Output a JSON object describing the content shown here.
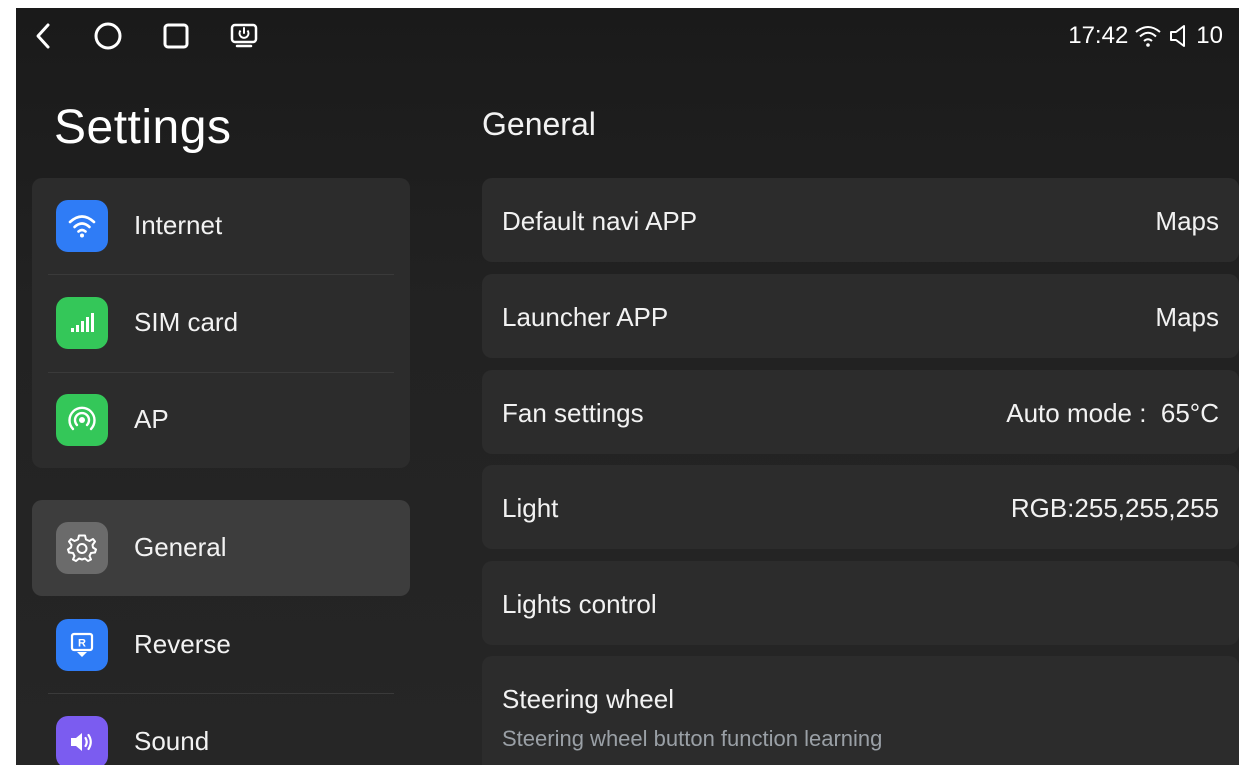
{
  "status_bar": {
    "nav": [
      {
        "icon": "back-icon"
      },
      {
        "icon": "home-icon"
      },
      {
        "icon": "recents-icon"
      },
      {
        "icon": "screen-power-icon"
      }
    ],
    "time": "17:42",
    "wifi_icon": "wifi-icon",
    "volume_icon": "volume-icon",
    "volume_level": "10"
  },
  "sidebar": {
    "title": "Settings",
    "items": [
      {
        "label": "Internet",
        "icon": "wifi-icon",
        "color": "#2f7cf6"
      },
      {
        "label": "SIM card",
        "icon": "signal-icon",
        "color": "#34c759"
      },
      {
        "label": "AP",
        "icon": "hotspot-icon",
        "color": "#34c759"
      },
      {
        "label": "General",
        "icon": "gear-icon",
        "color": "#6b6b6b",
        "selected": true
      },
      {
        "label": "Reverse",
        "icon": "reverse-camera-icon",
        "color": "#2f7cf6"
      },
      {
        "label": "Sound",
        "icon": "speaker-icon",
        "color": "#7b5cf0"
      }
    ]
  },
  "main": {
    "title": "General",
    "rows": [
      {
        "label": "Default navi APP",
        "value": "Maps"
      },
      {
        "label": "Launcher APP",
        "value": "Maps"
      },
      {
        "label": "Fan settings",
        "value": "Auto mode :  65°C"
      },
      {
        "label": "Light",
        "value": "RGB:255,255,255"
      },
      {
        "label": "Lights control",
        "value": ""
      },
      {
        "label": "Steering wheel",
        "sublabel": "Steering wheel button function learning"
      }
    ]
  }
}
